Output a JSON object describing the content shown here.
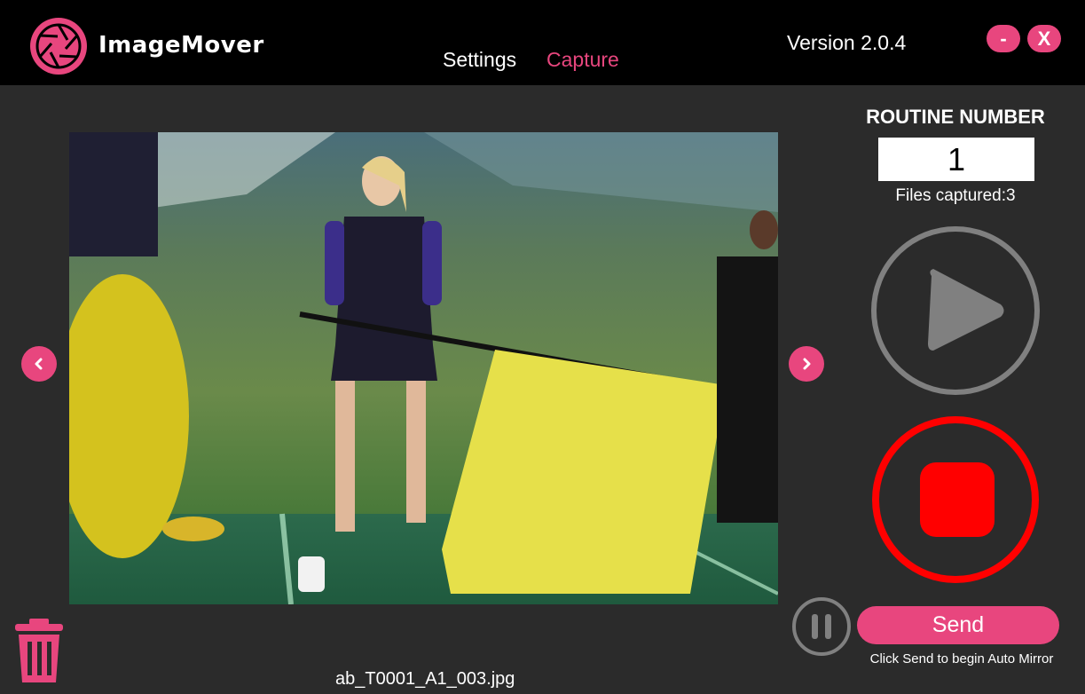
{
  "app": {
    "name": "ImageMover",
    "version": "Version 2.0.4"
  },
  "nav": {
    "tabs": [
      {
        "label": "Settings",
        "active": false
      },
      {
        "label": "Capture",
        "active": true
      }
    ]
  },
  "window_controls": {
    "minimize": "-",
    "close": "X"
  },
  "viewer": {
    "filename": "ab_T0001_A1_003.jpg"
  },
  "routine": {
    "title": "ROUTINE NUMBER",
    "number": "1",
    "files_captured_label": "Files captured:",
    "files_captured_count": "3"
  },
  "actions": {
    "send_label": "Send",
    "send_hint": "Click Send to begin Auto Mirror"
  },
  "colors": {
    "accent": "#e8467e",
    "background": "#2b2b2b",
    "titlebar": "#000000",
    "record": "#ff0000",
    "play": "#808080"
  },
  "icons": {
    "logo": "camera-shutter-icon",
    "prev": "chevron-left-icon",
    "next": "chevron-right-icon",
    "trash": "trash-icon",
    "play": "play-icon",
    "record": "record-stop-icon",
    "pause": "pause-icon"
  }
}
